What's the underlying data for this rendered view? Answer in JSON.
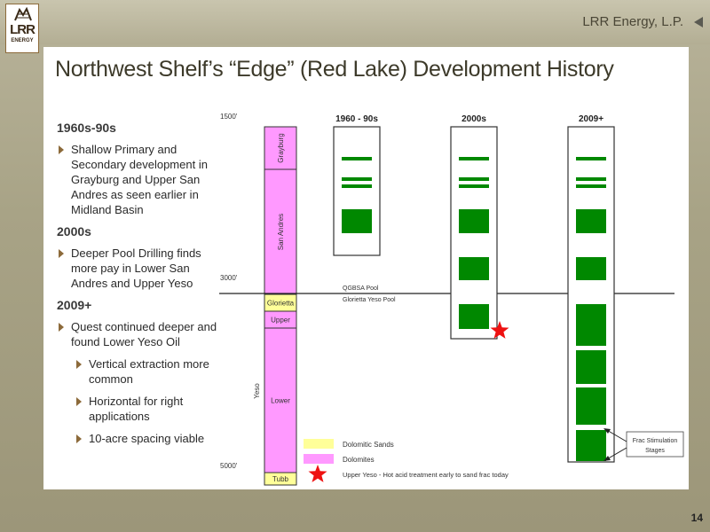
{
  "header": {
    "company": "LRR Energy, L.P.",
    "logo_text": "LRR",
    "logo_sub": "ENERGY",
    "title": "Northwest Shelf’s “Edge” (Red Lake) Development History",
    "page_number": "14"
  },
  "bullets": [
    {
      "type": "head",
      "text": "1960s-90s"
    },
    {
      "type": "item",
      "text": "Shallow Primary and Secondary development in Grayburg and Upper San Andres as seen earlier in Midland Basin"
    },
    {
      "type": "head",
      "text": "2000s"
    },
    {
      "type": "item",
      "text": "Deeper Pool Drilling finds more pay in Lower San Andres and Upper Yeso"
    },
    {
      "type": "head",
      "text": "2009+"
    },
    {
      "type": "item",
      "text": "Quest continued deeper and found Lower Yeso Oil"
    },
    {
      "type": "sub",
      "text": "Vertical extraction more common"
    },
    {
      "type": "sub",
      "text": "Horizontal for right applications"
    },
    {
      "type": "sub",
      "text": "10-acre spacing viable"
    }
  ],
  "diagram": {
    "depth_labels": [
      "1500'",
      "3000'",
      "5000'"
    ],
    "formations": [
      {
        "name": "Grayburg",
        "color": "#ff99ff"
      },
      {
        "name": "San Andres",
        "color": "#ff99ff"
      },
      {
        "name": "Glorietta",
        "color": "#ffff99"
      },
      {
        "name": "Upper",
        "color": "#ff99ff"
      },
      {
        "name": "Lower",
        "color": "#ff99ff"
      },
      {
        "name": "Tubb",
        "color": "#ffff99"
      }
    ],
    "yeso_label": "Yeso",
    "column_headers": [
      "1960 - 90s",
      "2000s",
      "2009+"
    ],
    "pool_labels": [
      "QGBSA Pool",
      "Glorietta Yeso Pool"
    ],
    "frac_label": "Frac Stimulation Stages",
    "legend": [
      {
        "label": "Dolomitic Sands",
        "color": "#ffff99"
      },
      {
        "label": "Dolomites",
        "color": "#ff99ff"
      },
      {
        "label": "Upper Yeso - Hot acid treatment early to sand frac today",
        "color": "#ee1111"
      }
    ],
    "pay_color": "#008800",
    "star_color": "#ee1111"
  }
}
